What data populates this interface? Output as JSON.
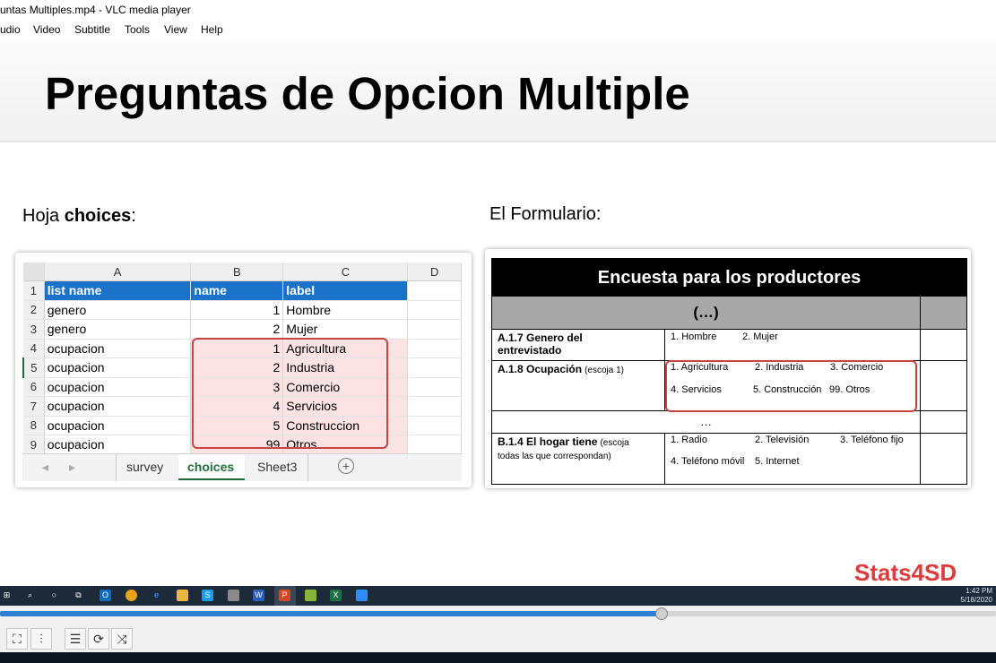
{
  "window": {
    "title": "untas Multiples.mp4 - VLC media player"
  },
  "menu": [
    "udio",
    "Video",
    "Subtitle",
    "Tools",
    "View",
    "Help"
  ],
  "slide": {
    "title": "Preguntas de Opcion Multiple",
    "left_heading_pre": "Hoja ",
    "left_heading_bold": "choices",
    "left_heading_post": ":",
    "right_heading": "El Formulario:"
  },
  "excel": {
    "col_headers": [
      "A",
      "B",
      "C",
      "D"
    ],
    "rows": [
      {
        "n": "1",
        "a": "list name",
        "b": "name",
        "c": "label"
      },
      {
        "n": "2",
        "a": "genero",
        "b": "1",
        "c": "Hombre"
      },
      {
        "n": "3",
        "a": "genero",
        "b": "2",
        "c": "Mujer"
      },
      {
        "n": "4",
        "a": "ocupacion",
        "b": "1",
        "c": "Agricultura"
      },
      {
        "n": "5",
        "a": "ocupacion",
        "b": "2",
        "c": "Industria"
      },
      {
        "n": "6",
        "a": "ocupacion",
        "b": "3",
        "c": "Comercio"
      },
      {
        "n": "7",
        "a": "ocupacion",
        "b": "4",
        "c": "Servicios"
      },
      {
        "n": "8",
        "a": "ocupacion",
        "b": "5",
        "c": "Construccion"
      },
      {
        "n": "9",
        "a": "ocupacion",
        "b": "99",
        "c": "Otros"
      }
    ],
    "sheet_tabs": [
      "survey",
      "choices",
      "Sheet3"
    ],
    "active_tab": "choices",
    "header_color": "#1a73c9",
    "highlight_color": "#fbe3e3"
  },
  "form": {
    "banner": "Encuesta para los productores",
    "ellipsis_row": "(…)",
    "q1_label": "A.1.7 Genero del entrevistado",
    "q1_opt1": "1. Hombre",
    "q1_opt2": "2. Mujer",
    "q2_label_bold": "A.1.8 Ocupación",
    "q2_label_note": "(escoja 1)",
    "q2_opt1": "1. Agricultura",
    "q2_opt2": "2. Industria",
    "q2_opt3": "3. Comercio",
    "q2_opt4": "4. Servicios",
    "q2_opt5": "5. Construcción",
    "q2_opt6": "99. Otros",
    "dots": "…",
    "q3_label_bold": "B.1.4 El hogar tiene",
    "q3_label_note1": "(escoja",
    "q3_label_note2": "todas las que correspondan)",
    "q3_opt1": "1. Radio",
    "q3_opt2": "2. Televisión",
    "q3_opt3": "3. Teléfono fijo",
    "q3_opt4": "4. Teléfono  móvil",
    "q3_opt5": "5. Internet"
  },
  "brand": "Stats4SD",
  "taskbar": {
    "time": "1:42 PM",
    "date": "5/18/2020"
  },
  "player": {
    "progress": 0.664,
    "accent": "#2d7fd0"
  }
}
